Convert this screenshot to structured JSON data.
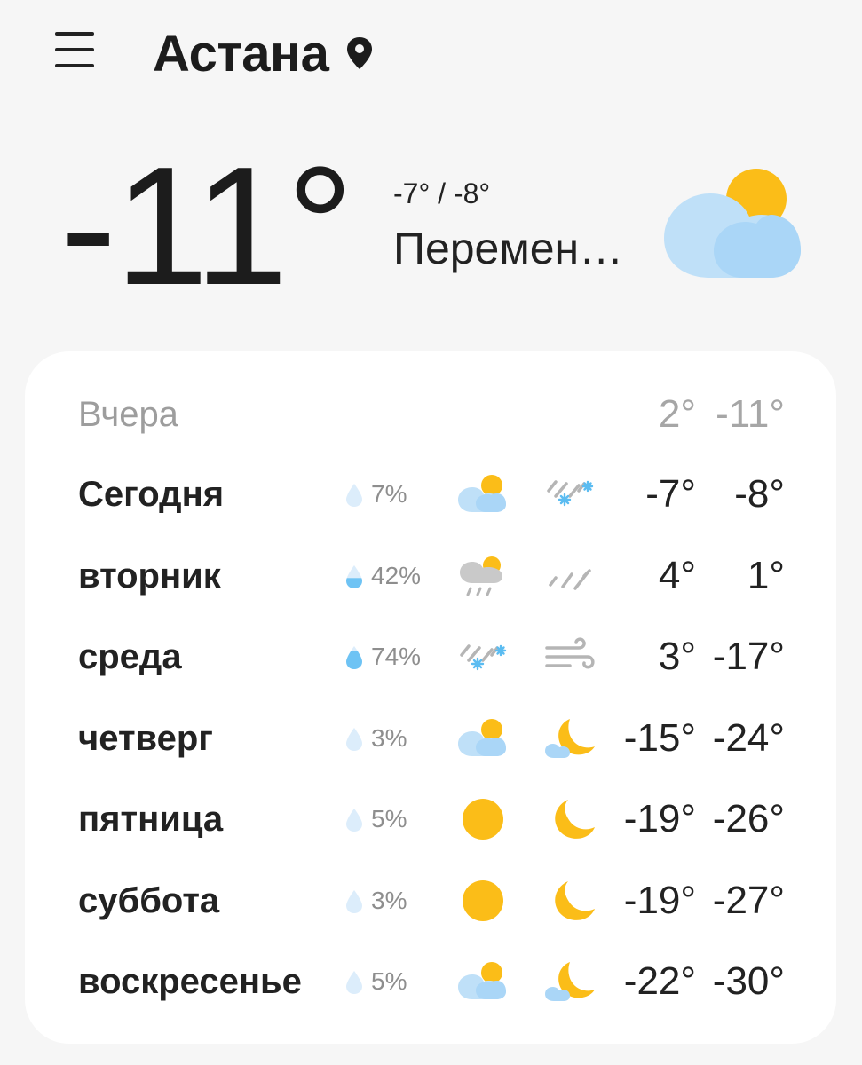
{
  "header": {
    "city": "Астана",
    "menu_icon": "hamburger-menu-icon",
    "location_icon": "location-pin-icon"
  },
  "current": {
    "temperature": "-11°",
    "high_low": "-7° / -8°",
    "condition": "Перемен…",
    "icon": "partly-cloudy-icon"
  },
  "forecast": {
    "yesterday": {
      "day": "Вчера",
      "max": "2°",
      "min": "-11°"
    },
    "days": [
      {
        "day": "Сегодня",
        "precip": "7%",
        "day_icon": "partly-cloudy-icon",
        "night_icon": "snow-rain-icon",
        "max": "-7°",
        "min": "-8°"
      },
      {
        "day": "вторник",
        "precip": "42%",
        "day_icon": "cloud-rain-sun-icon",
        "night_icon": "rain-icon",
        "max": "4°",
        "min": "1°"
      },
      {
        "day": "среда",
        "precip": "74%",
        "day_icon": "snow-rain-icon",
        "night_icon": "wind-icon",
        "max": "3°",
        "min": "-17°"
      },
      {
        "day": "четверг",
        "precip": "3%",
        "day_icon": "partly-cloudy-icon",
        "night_icon": "moon-cloud-icon",
        "max": "-15°",
        "min": "-24°"
      },
      {
        "day": "пятница",
        "precip": "5%",
        "day_icon": "sun-icon",
        "night_icon": "moon-icon",
        "max": "-19°",
        "min": "-26°"
      },
      {
        "day": "суббота",
        "precip": "3%",
        "day_icon": "sun-icon",
        "night_icon": "moon-icon",
        "max": "-19°",
        "min": "-27°"
      },
      {
        "day": "воскресенье",
        "precip": "5%",
        "day_icon": "partly-cloudy-icon",
        "night_icon": "moon-cloud-icon",
        "max": "-22°",
        "min": "-30°"
      }
    ]
  },
  "colors": {
    "background": "#f6f6f6",
    "card": "#ffffff",
    "sun": "#fbbd18",
    "cloud": "#bfe0f8",
    "text": "#1c1c1c",
    "muted": "#9d9d9d"
  }
}
